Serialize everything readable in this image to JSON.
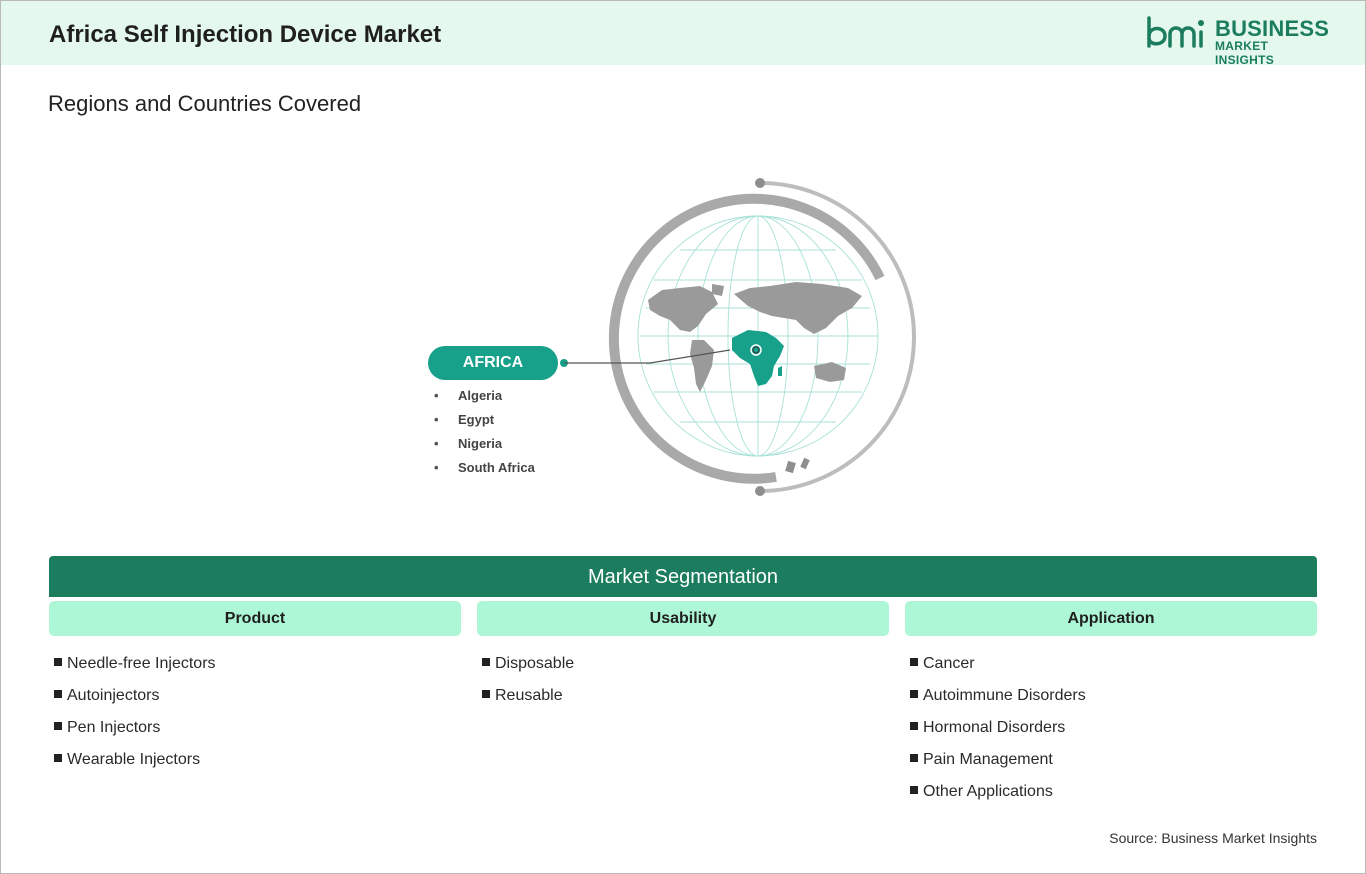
{
  "header": {
    "title": "Africa Self Injection Device Market",
    "logo": {
      "mark": "bmi",
      "line1": "BUSINESS",
      "line2": "MARKET INSIGHTS",
      "color": "#1b7d5e"
    }
  },
  "regions_section": {
    "title": "Regions and Countries Covered",
    "region": {
      "name": "AFRICA",
      "color": "#17a08a",
      "countries": [
        "Algeria",
        "Egypt",
        "Nigeria",
        "South Africa"
      ]
    },
    "globe_icon": "world-map-globe-icon"
  },
  "segmentation": {
    "title": "Market Segmentation",
    "bar_color": "#1b7d5e",
    "header_color": "#aef7d6",
    "columns": [
      {
        "heading": "Product",
        "items": [
          "Needle-free Injectors",
          "Autoinjectors",
          "Pen Injectors",
          "Wearable Injectors"
        ]
      },
      {
        "heading": "Usability",
        "items": [
          "Disposable",
          "Reusable"
        ]
      },
      {
        "heading": "Application",
        "items": [
          "Cancer",
          "Autoimmune Disorders",
          "Hormonal Disorders",
          "Pain Management",
          "Other Applications"
        ]
      }
    ]
  },
  "footer": {
    "source": "Source: Business Market Insights"
  }
}
